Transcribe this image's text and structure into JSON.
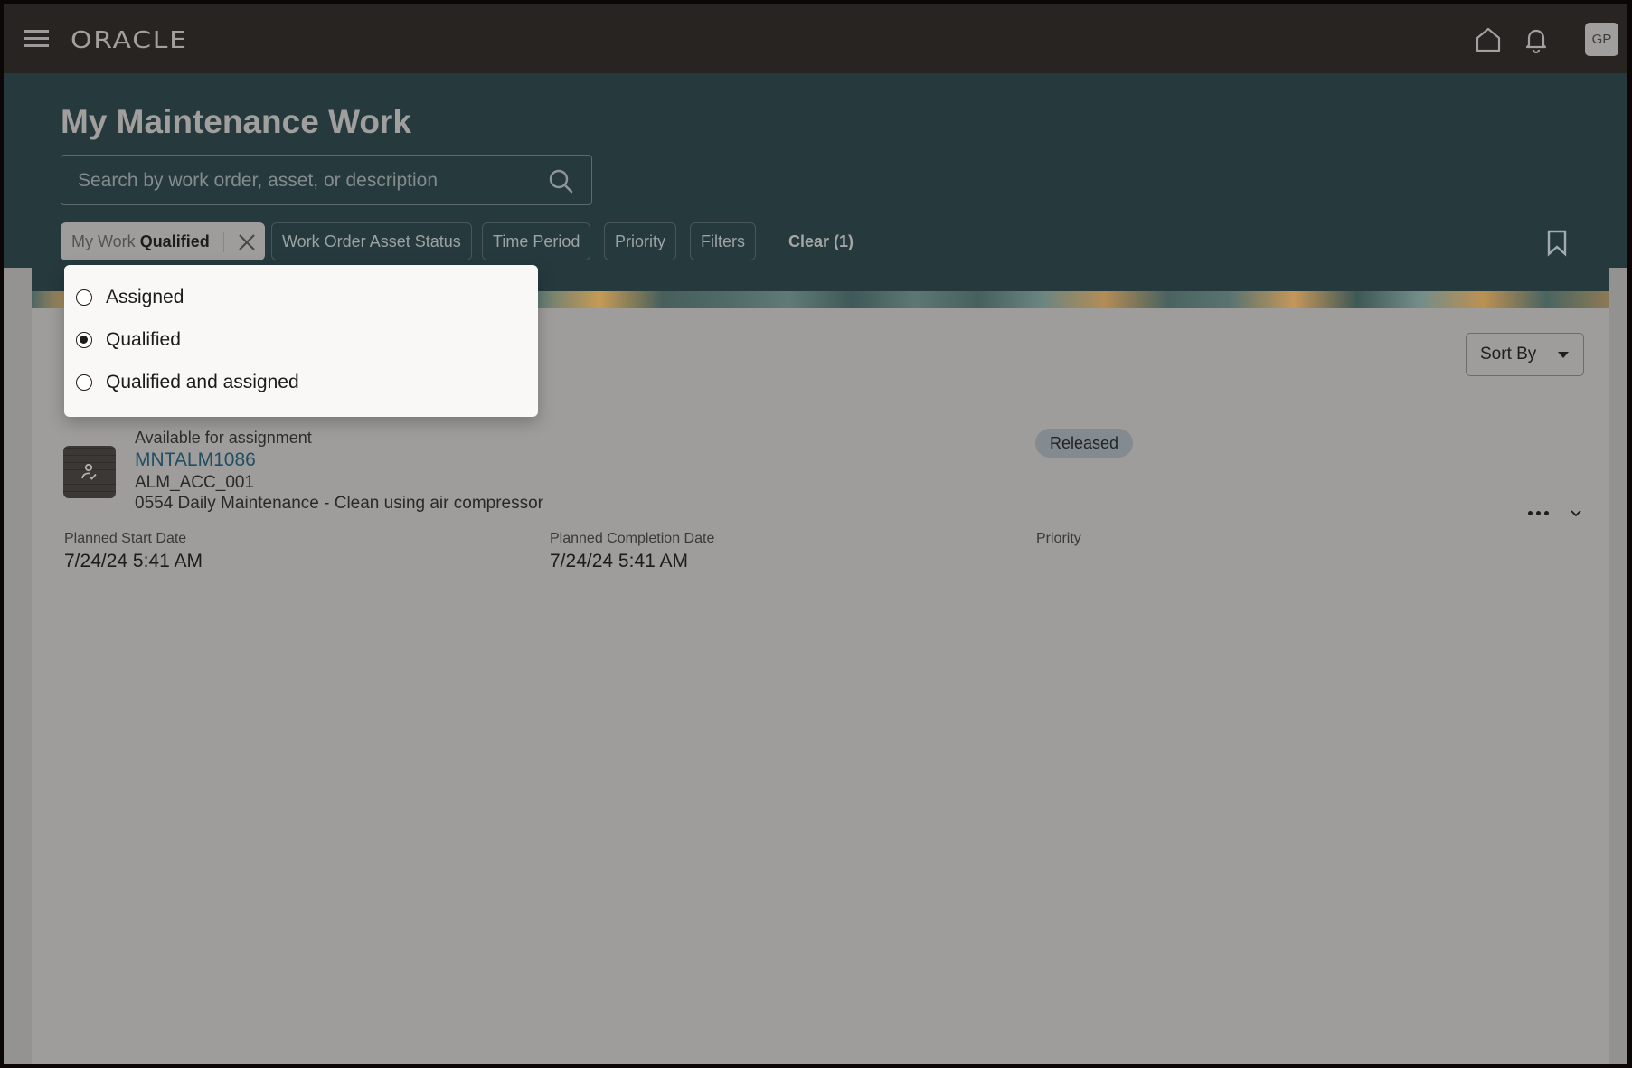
{
  "appbar": {
    "brand": "ORACLE",
    "user_initials": "GP",
    "icons": [
      "menu-icon",
      "home-icon",
      "bell-icon"
    ]
  },
  "header": {
    "title": "My Maintenance Work",
    "search": {
      "placeholder": "Search by work order, asset, or description",
      "value": ""
    }
  },
  "filters": {
    "active_chip": {
      "label": "My Work",
      "value": "Qualified"
    },
    "chips": [
      "Work Order Asset Status",
      "Time Period",
      "Priority",
      "Filters"
    ],
    "clear_label": "Clear (1)"
  },
  "dropdown": {
    "options": [
      {
        "label": "Assigned",
        "selected": false
      },
      {
        "label": "Qualified",
        "selected": true
      },
      {
        "label": "Qualified and assigned",
        "selected": false
      }
    ]
  },
  "toolbar": {
    "sort_label": "Sort By"
  },
  "work_orders": [
    {
      "availability": "Available for assignment",
      "number": "MNTALM1086",
      "asset": "ALM_ACC_001",
      "description": "0554 Daily Maintenance - Clean using air compressor",
      "status": "Released",
      "fields": [
        {
          "label": "Planned Start Date",
          "value": "7/24/24 5:41 AM"
        },
        {
          "label": "Planned Completion Date",
          "value": "7/24/24 5:41 AM"
        },
        {
          "label": "Priority",
          "value": ""
        }
      ]
    }
  ]
}
